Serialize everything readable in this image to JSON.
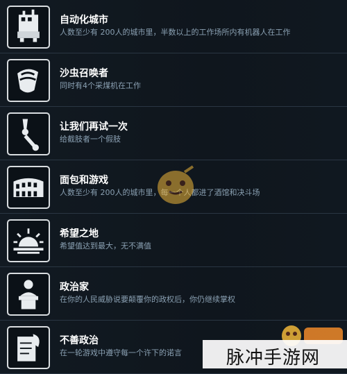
{
  "achievements": [
    {
      "title": "自动化城市",
      "desc": "人数至少有 200人的城市里，半数以上的工作场所内有机器人在工作",
      "icon": "robot-worker-icon"
    },
    {
      "title": "沙虫召唤者",
      "desc": "同时有4个采煤机在工作",
      "icon": "sandworm-icon"
    },
    {
      "title": "让我们再试一次",
      "desc": "给截肢者一个假肢",
      "icon": "prosthetic-arm-icon"
    },
    {
      "title": "面包和游戏",
      "desc": "人数至少有 200人的城市里，每一个人都进了酒馆和决斗场",
      "icon": "colosseum-icon"
    },
    {
      "title": "希望之地",
      "desc": "希望值达到最大，无不满值",
      "icon": "sunrise-icon"
    },
    {
      "title": "政治家",
      "desc": "在你的人民威胁说要颠覆你的政权后，你仍继续掌权",
      "icon": "politician-podium-icon"
    },
    {
      "title": "不善政治",
      "desc": "在一轮游戏中遵守每一个许下的诺言",
      "icon": "scroll-quill-icon"
    }
  ],
  "watermark": {
    "text": "脉冲手游网",
    "badge": "九游"
  }
}
